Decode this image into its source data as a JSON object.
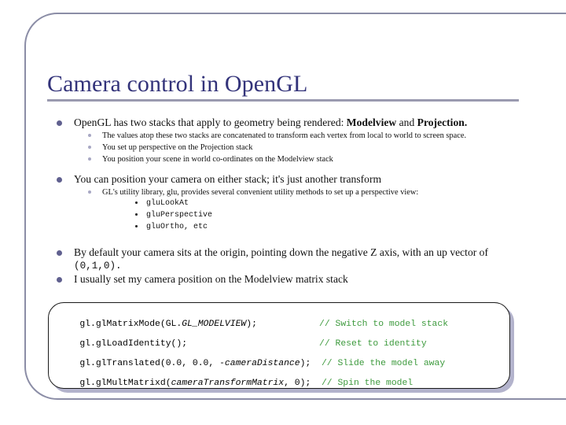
{
  "slide": {
    "title": "Camera control in OpenGL",
    "theme": {
      "title_color": "#33337a",
      "rule_color": "#9a9ab0",
      "frame_color": "#8b8da6",
      "bullet_l1_color": "#60608f",
      "bullet_l2_color": "#a8a8c4",
      "bullet_l3_color": "#1b1b1b",
      "code_comment_color": "#3d9a3d",
      "code_text_color": "#000000",
      "code_shadow_color": "#b3b3cc"
    },
    "bullets": [
      {
        "level": 1,
        "text_before": "OpenGL has two stacks that apply to geometry being rendered: ",
        "bold_1": "Modelview",
        "text_mid": " and ",
        "bold_2": "Projection.",
        "text_after": ""
      },
      {
        "level": 2,
        "text": "The values atop these two stacks are concatenated to transform each vertex from local to world to screen space."
      },
      {
        "level": 2,
        "text": "You set up perspective on the Projection stack"
      },
      {
        "level": 2,
        "text": "You position your scene in world co-ordinates on the Modelview stack"
      },
      {
        "level": 1,
        "text": "You can position your camera on either stack; it's just another transform"
      },
      {
        "level": 2,
        "text": "GL's utility library, glu, provides several convenient utility methods to set up a perspective view:"
      },
      {
        "level": 3,
        "text": "gluLookAt"
      },
      {
        "level": 3,
        "text": "gluPerspective"
      },
      {
        "level": 3,
        "text": "gluOrtho, etc"
      },
      {
        "level": 1,
        "text_before": "By default your camera sits at the origin, pointing down the negative Z axis, with an up vector of ",
        "mono": "(0,1,0).",
        "text_after": ""
      },
      {
        "level": 1,
        "text": "I usually set my camera position on the Modelview matrix stack"
      }
    ],
    "code_block": {
      "lines": [
        {
          "code_a": "gl.glMatrixMode(GL.",
          "code_italic": "GL_MODELVIEW",
          "code_b": ");",
          "comment": "// Switch to model stack",
          "comment_far": true
        },
        {
          "code_a": "gl.glLoadIdentity();",
          "code_italic": "",
          "code_b": "",
          "comment": "// Reset to identity",
          "comment_far": true
        },
        {
          "code_a": "gl.glTranslated(0.0, 0.0, -",
          "code_italic": "cameraDistance",
          "code_b": ");",
          "comment": "// Slide the model away",
          "comment_far": false
        },
        {
          "code_a": "gl.glMultMatrixd(",
          "code_italic": "cameraTransformMatrix",
          "code_b": ", 0);",
          "comment": "// Spin the model",
          "comment_far": false
        }
      ]
    }
  }
}
